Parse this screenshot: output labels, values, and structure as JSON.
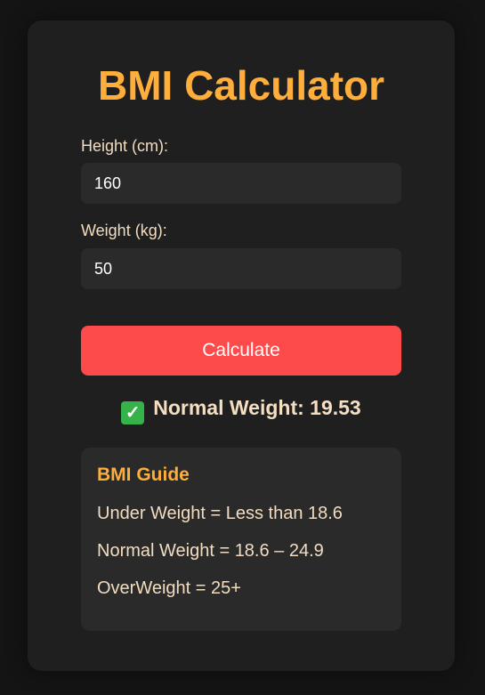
{
  "app": {
    "title": "BMI Calculator"
  },
  "form": {
    "height_label": "Height (cm):",
    "height_value": "160",
    "weight_label": "Weight (kg):",
    "weight_value": "50",
    "calculate_label": "Calculate"
  },
  "result": {
    "icon": "check-mark-icon",
    "icon_glyph": "✓",
    "text": "Normal Weight: 19.53"
  },
  "guide": {
    "title": "BMI Guide",
    "items": [
      "Under Weight = Less than 18.6",
      "Normal Weight = 18.6 – 24.9",
      "OverWeight = 25+"
    ]
  },
  "colors": {
    "background": "#141414",
    "card": "#1f1f1f",
    "accent": "#ffad3b",
    "button": "#fd4a4a",
    "field": "#2a2a2a",
    "text": "#f2dcc0",
    "success": "#35b24a"
  }
}
